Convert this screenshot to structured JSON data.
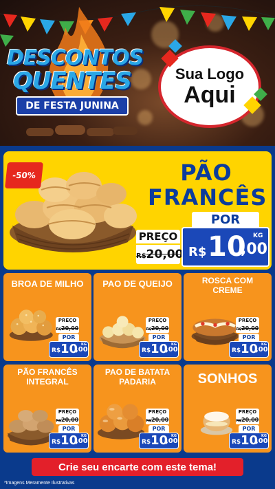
{
  "header": {
    "title_line1": "DESCONTOS",
    "title_line2": "QUENTES",
    "title_band": "DE FESTA JUNINA",
    "logo_line1": "Sua Logo",
    "logo_line2": "Aqui"
  },
  "hero": {
    "badge": "-50%",
    "name_line1": "PÃO",
    "name_line2": "FRANCÊS",
    "price": {
      "preco_label": "PREÇO",
      "old_currency": "R$",
      "old_price": "20,00",
      "por_label": "POR",
      "currency": "R$",
      "price_int": "10",
      "price_dec": ",00",
      "unit": "KG"
    }
  },
  "products": [
    {
      "title": "BROA DE MILHO",
      "preco_label": "PREÇO",
      "old_currency": "R$",
      "old_price": "20,00",
      "por_label": "POR",
      "currency": "R$",
      "price_int": "10",
      "price_dec": ",00",
      "unit": "KG"
    },
    {
      "title": "PAO DE QUEIJO",
      "preco_label": "PREÇO",
      "old_currency": "R$",
      "old_price": "20,00",
      "por_label": "POR",
      "currency": "R$",
      "price_int": "10",
      "price_dec": ",00",
      "unit": "KG"
    },
    {
      "title": "ROSCA COM CREME",
      "preco_label": "PREÇO",
      "old_currency": "R$",
      "old_price": "20,00",
      "por_label": "POR",
      "currency": "R$",
      "price_int": "10",
      "price_dec": ",00",
      "unit": "KG"
    },
    {
      "title": "PÃO FRANCÊS INTEGRAL",
      "preco_label": "PREÇO",
      "old_currency": "R$",
      "old_price": "20,00",
      "por_label": "POR",
      "currency": "R$",
      "price_int": "10",
      "price_dec": ",00",
      "unit": "KG"
    },
    {
      "title": "PAO DE BATATA PADARIA",
      "preco_label": "PREÇO",
      "old_currency": "R$",
      "old_price": "20,00",
      "por_label": "POR",
      "currency": "R$",
      "price_int": "10",
      "price_dec": ",00",
      "unit": "KG"
    },
    {
      "title": "SONHOS",
      "preco_label": "PREÇO",
      "old_currency": "R$",
      "old_price": "20,00",
      "por_label": "POR",
      "currency": "R$",
      "price_int": "10",
      "price_dec": ",00",
      "unit": "KG"
    }
  ],
  "footer": {
    "cta": "Crie seu encarte com este tema!",
    "note": "*Imagens Meramente Ilustrativas"
  },
  "colors": {
    "background_blue": "#0a3a8c",
    "hero_yellow": "#ffd400",
    "card_orange": "#f7941d",
    "price_blue": "#1b48b8",
    "badge_red": "#e6281e",
    "cta_red": "#e3202a"
  }
}
